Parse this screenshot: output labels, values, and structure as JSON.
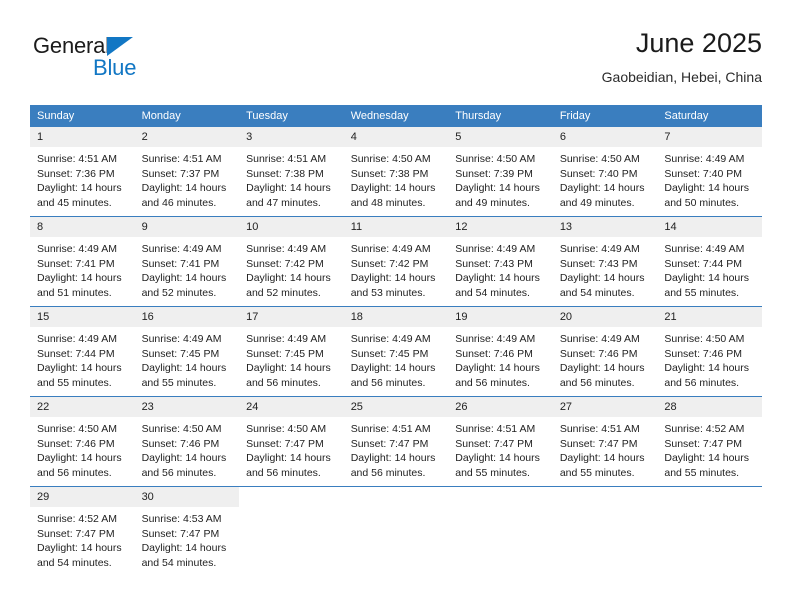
{
  "logo": {
    "text_top": "General",
    "text_bottom": "Blue",
    "triangle_color": "#1277c4"
  },
  "header": {
    "title": "June 2025",
    "subtitle": "Gaobeidian, Hebei, China"
  },
  "theme": {
    "header_bg": "#3a7ebf",
    "daynum_bg": "#efefef",
    "text": "#222222"
  },
  "calendar": {
    "weekday_headers": [
      "Sunday",
      "Monday",
      "Tuesday",
      "Wednesday",
      "Thursday",
      "Friday",
      "Saturday"
    ],
    "weeks": [
      [
        {
          "day": "1",
          "sunrise": "Sunrise: 4:51 AM",
          "sunset": "Sunset: 7:36 PM",
          "daylight": "Daylight: 14 hours and 45 minutes."
        },
        {
          "day": "2",
          "sunrise": "Sunrise: 4:51 AM",
          "sunset": "Sunset: 7:37 PM",
          "daylight": "Daylight: 14 hours and 46 minutes."
        },
        {
          "day": "3",
          "sunrise": "Sunrise: 4:51 AM",
          "sunset": "Sunset: 7:38 PM",
          "daylight": "Daylight: 14 hours and 47 minutes."
        },
        {
          "day": "4",
          "sunrise": "Sunrise: 4:50 AM",
          "sunset": "Sunset: 7:38 PM",
          "daylight": "Daylight: 14 hours and 48 minutes."
        },
        {
          "day": "5",
          "sunrise": "Sunrise: 4:50 AM",
          "sunset": "Sunset: 7:39 PM",
          "daylight": "Daylight: 14 hours and 49 minutes."
        },
        {
          "day": "6",
          "sunrise": "Sunrise: 4:50 AM",
          "sunset": "Sunset: 7:40 PM",
          "daylight": "Daylight: 14 hours and 49 minutes."
        },
        {
          "day": "7",
          "sunrise": "Sunrise: 4:49 AM",
          "sunset": "Sunset: 7:40 PM",
          "daylight": "Daylight: 14 hours and 50 minutes."
        }
      ],
      [
        {
          "day": "8",
          "sunrise": "Sunrise: 4:49 AM",
          "sunset": "Sunset: 7:41 PM",
          "daylight": "Daylight: 14 hours and 51 minutes."
        },
        {
          "day": "9",
          "sunrise": "Sunrise: 4:49 AM",
          "sunset": "Sunset: 7:41 PM",
          "daylight": "Daylight: 14 hours and 52 minutes."
        },
        {
          "day": "10",
          "sunrise": "Sunrise: 4:49 AM",
          "sunset": "Sunset: 7:42 PM",
          "daylight": "Daylight: 14 hours and 52 minutes."
        },
        {
          "day": "11",
          "sunrise": "Sunrise: 4:49 AM",
          "sunset": "Sunset: 7:42 PM",
          "daylight": "Daylight: 14 hours and 53 minutes."
        },
        {
          "day": "12",
          "sunrise": "Sunrise: 4:49 AM",
          "sunset": "Sunset: 7:43 PM",
          "daylight": "Daylight: 14 hours and 54 minutes."
        },
        {
          "day": "13",
          "sunrise": "Sunrise: 4:49 AM",
          "sunset": "Sunset: 7:43 PM",
          "daylight": "Daylight: 14 hours and 54 minutes."
        },
        {
          "day": "14",
          "sunrise": "Sunrise: 4:49 AM",
          "sunset": "Sunset: 7:44 PM",
          "daylight": "Daylight: 14 hours and 55 minutes."
        }
      ],
      [
        {
          "day": "15",
          "sunrise": "Sunrise: 4:49 AM",
          "sunset": "Sunset: 7:44 PM",
          "daylight": "Daylight: 14 hours and 55 minutes."
        },
        {
          "day": "16",
          "sunrise": "Sunrise: 4:49 AM",
          "sunset": "Sunset: 7:45 PM",
          "daylight": "Daylight: 14 hours and 55 minutes."
        },
        {
          "day": "17",
          "sunrise": "Sunrise: 4:49 AM",
          "sunset": "Sunset: 7:45 PM",
          "daylight": "Daylight: 14 hours and 56 minutes."
        },
        {
          "day": "18",
          "sunrise": "Sunrise: 4:49 AM",
          "sunset": "Sunset: 7:45 PM",
          "daylight": "Daylight: 14 hours and 56 minutes."
        },
        {
          "day": "19",
          "sunrise": "Sunrise: 4:49 AM",
          "sunset": "Sunset: 7:46 PM",
          "daylight": "Daylight: 14 hours and 56 minutes."
        },
        {
          "day": "20",
          "sunrise": "Sunrise: 4:49 AM",
          "sunset": "Sunset: 7:46 PM",
          "daylight": "Daylight: 14 hours and 56 minutes."
        },
        {
          "day": "21",
          "sunrise": "Sunrise: 4:50 AM",
          "sunset": "Sunset: 7:46 PM",
          "daylight": "Daylight: 14 hours and 56 minutes."
        }
      ],
      [
        {
          "day": "22",
          "sunrise": "Sunrise: 4:50 AM",
          "sunset": "Sunset: 7:46 PM",
          "daylight": "Daylight: 14 hours and 56 minutes."
        },
        {
          "day": "23",
          "sunrise": "Sunrise: 4:50 AM",
          "sunset": "Sunset: 7:46 PM",
          "daylight": "Daylight: 14 hours and 56 minutes."
        },
        {
          "day": "24",
          "sunrise": "Sunrise: 4:50 AM",
          "sunset": "Sunset: 7:47 PM",
          "daylight": "Daylight: 14 hours and 56 minutes."
        },
        {
          "day": "25",
          "sunrise": "Sunrise: 4:51 AM",
          "sunset": "Sunset: 7:47 PM",
          "daylight": "Daylight: 14 hours and 56 minutes."
        },
        {
          "day": "26",
          "sunrise": "Sunrise: 4:51 AM",
          "sunset": "Sunset: 7:47 PM",
          "daylight": "Daylight: 14 hours and 55 minutes."
        },
        {
          "day": "27",
          "sunrise": "Sunrise: 4:51 AM",
          "sunset": "Sunset: 7:47 PM",
          "daylight": "Daylight: 14 hours and 55 minutes."
        },
        {
          "day": "28",
          "sunrise": "Sunrise: 4:52 AM",
          "sunset": "Sunset: 7:47 PM",
          "daylight": "Daylight: 14 hours and 55 minutes."
        }
      ],
      [
        {
          "day": "29",
          "sunrise": "Sunrise: 4:52 AM",
          "sunset": "Sunset: 7:47 PM",
          "daylight": "Daylight: 14 hours and 54 minutes."
        },
        {
          "day": "30",
          "sunrise": "Sunrise: 4:53 AM",
          "sunset": "Sunset: 7:47 PM",
          "daylight": "Daylight: 14 hours and 54 minutes."
        },
        {
          "day": "",
          "sunrise": "",
          "sunset": "",
          "daylight": ""
        },
        {
          "day": "",
          "sunrise": "",
          "sunset": "",
          "daylight": ""
        },
        {
          "day": "",
          "sunrise": "",
          "sunset": "",
          "daylight": ""
        },
        {
          "day": "",
          "sunrise": "",
          "sunset": "",
          "daylight": ""
        },
        {
          "day": "",
          "sunrise": "",
          "sunset": "",
          "daylight": ""
        }
      ]
    ]
  }
}
